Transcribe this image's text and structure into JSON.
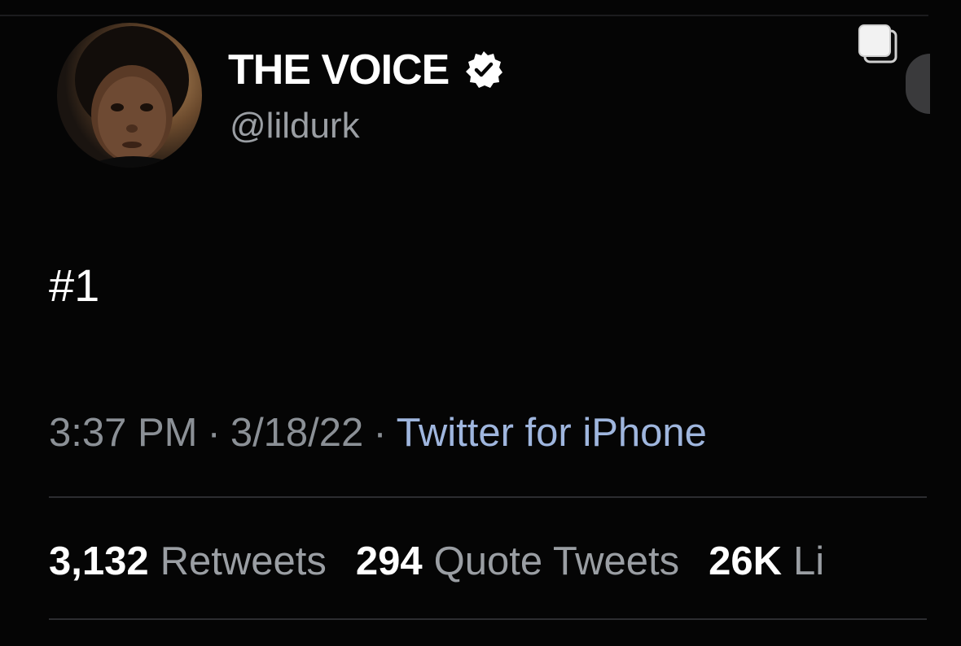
{
  "tweet": {
    "author": {
      "display_name": "THE VOICE",
      "handle": "@lildurk",
      "verified": true
    },
    "text": "#1",
    "meta": {
      "time": "3:37 PM",
      "separator": "·",
      "date": "3/18/22",
      "source": "Twitter for iPhone"
    },
    "stats": [
      {
        "count": "3,132",
        "label": "Retweets"
      },
      {
        "count": "294",
        "label": "Quote Tweets"
      },
      {
        "count": "26K",
        "label": "Li"
      }
    ]
  },
  "icons": {
    "verified": "verified-badge-icon",
    "copy": "copy-icon"
  },
  "colors": {
    "background": "#050505",
    "primary_text": "#ffffff",
    "secondary_text": "#9a9ea3",
    "link": "#9fb6de"
  }
}
